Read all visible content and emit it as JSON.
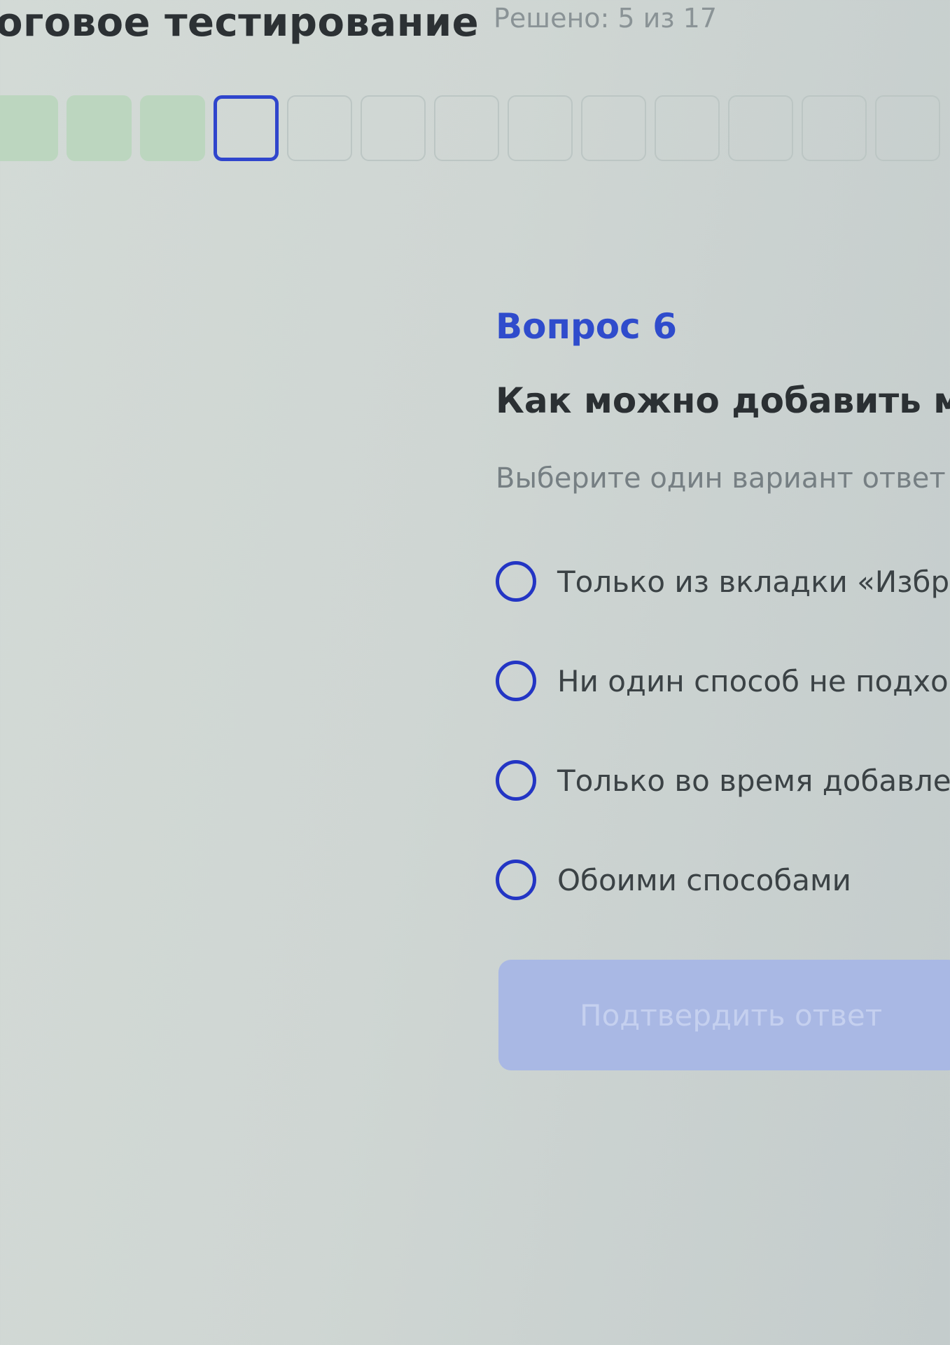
{
  "header": {
    "title": "оговое тестирование",
    "progress": "Решено: 5 из 17"
  },
  "question_nav": {
    "total_visible": 13,
    "completed": 3,
    "current_index": 3
  },
  "question": {
    "number_label": "Вопрос 6",
    "text": "Как можно добавить ма",
    "instruction": "Выберите один вариант ответ",
    "options": [
      {
        "label": "Только из вкладки «Избр"
      },
      {
        "label": "Ни один способ не подхо"
      },
      {
        "label": "Только во время добавле"
      },
      {
        "label": "Обоими способами"
      }
    ]
  },
  "actions": {
    "confirm_label": "Подтвердить ответ"
  },
  "colors": {
    "accent": "#2f45cc",
    "done": "#bcd6bf",
    "button_disabled": "#a9b8e4"
  }
}
